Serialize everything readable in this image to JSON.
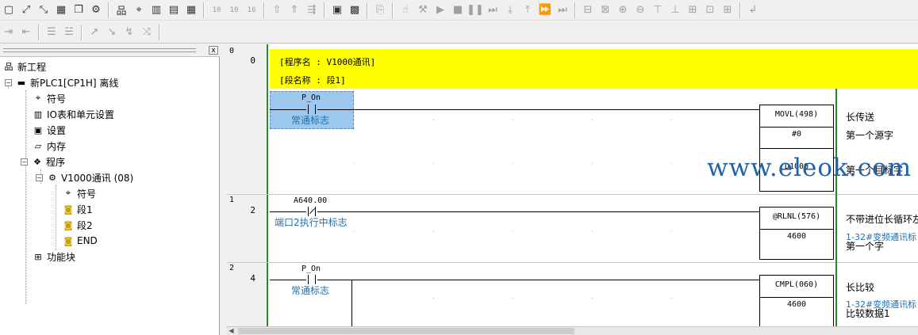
{
  "toolbar1": {
    "icons": [
      "new-icon",
      "zoom-icon",
      "zoom-fit-icon",
      "grid-icon",
      "window-icon",
      "settings-icon",
      "network-icon",
      "symbol-icon",
      "io-icon",
      "memory-icon",
      "table-icon"
    ],
    "step_labels": [
      "10",
      "10",
      "16"
    ]
  },
  "tree": {
    "items": [
      {
        "label": "新工程"
      },
      {
        "label": "新PLC1[CP1H] 离线"
      },
      {
        "label": "符号"
      },
      {
        "label": "IO表和单元设置"
      },
      {
        "label": "设置"
      },
      {
        "label": "内存"
      },
      {
        "label": "程序"
      },
      {
        "label": "V1000通讯 (08)"
      },
      {
        "label": "符号"
      },
      {
        "label": "段1"
      },
      {
        "label": "段2"
      },
      {
        "label": "END"
      },
      {
        "label": "功能块"
      }
    ],
    "close_label": "x"
  },
  "ladder": {
    "header": {
      "program_name": "[程序名 : V1000通讯]",
      "section_name": "[段名称 : 段1]"
    },
    "rungs": [
      {
        "rung": "0",
        "step": "0"
      },
      {
        "rung": "1",
        "step": "2"
      },
      {
        "rung": "2",
        "step": "4"
      }
    ],
    "rung0": {
      "contact_operand": "P_On",
      "contact_comment": "常通标志",
      "fb_name": "MOVL(498)",
      "fb_op1": "#0",
      "fb_op2": "D1000",
      "cmt_name": "长传送",
      "cmt_op1": "第一个源字",
      "cmt_op2": "第一个目标字"
    },
    "rung1": {
      "contact_operand": "A640.00",
      "contact_comment": "端口2执行中标志",
      "fb_name": "@RLNL(576)",
      "fb_op1": "4600",
      "cmt_name": "不带进位长循环左",
      "cmt_op1_blue": "1-32#变频通讯标",
      "cmt_op1": "第一个字"
    },
    "rung2": {
      "contact_operand": "P_On",
      "contact_comment": "常通标志",
      "fb_name": "CMPL(060)",
      "fb_op1": "4600",
      "cmt_name": "长比较",
      "cmt_op1_blue": "1-32#变频通讯标",
      "cmt_op1": "比较数据1"
    }
  },
  "watermark": "www.eleok.com"
}
